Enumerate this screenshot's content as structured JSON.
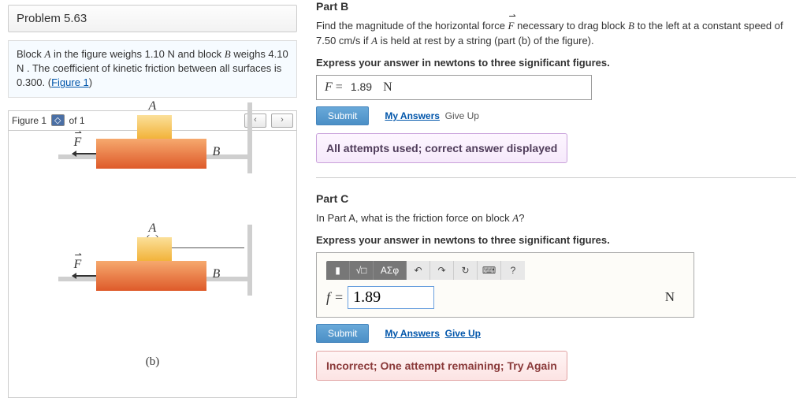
{
  "problem": {
    "header": "Problem 5.63",
    "desc_pre": "Block ",
    "desc_A": "A",
    "desc_mid1": " in the figure weighs 1.10 ",
    "desc_unitN1": "N",
    "desc_mid2": " and block ",
    "desc_B": "B",
    "desc_mid3": " weighs 4.10 ",
    "desc_unitN2": "N",
    "desc_mid4": " . The coefficient of kinetic friction between all surfaces is 0.300. (",
    "desc_figlink": "Figure 1",
    "desc_end": ")"
  },
  "figure": {
    "label": "Figure 1",
    "of": "of 1",
    "prev": "‹",
    "next": "›",
    "A": "A",
    "B": "B",
    "F": "F",
    "cap_a": "(a)",
    "cap_b": "(b)"
  },
  "partB": {
    "title": "Part B",
    "q_pre": "Find the magnitude of the horizontal force ",
    "q_F": "F",
    "q_mid1": " necessary to drag block ",
    "q_B": "B",
    "q_mid2": "  to the left at a constant speed of 7.50 ",
    "q_units": "cm/s",
    "q_mid3": " if ",
    "q_A": "A",
    "q_end": "  is held at rest by a string (part (b) of the figure).",
    "instr": "Express your answer in newtons to three significant figures.",
    "ansVar": "F",
    "ansEq": " = ",
    "ansVal": "1.89",
    "ansUnit": "N",
    "submit": "Submit",
    "myAnswers": "My Answers",
    "giveUp": "Give Up",
    "feedback": "All attempts used; correct answer displayed"
  },
  "partC": {
    "title": "Part C",
    "q_pre": "In Part A, what is the friction force on block ",
    "q_A": "A",
    "q_end": "?",
    "instr": "Express your answer in newtons to three significant figures.",
    "tool1": "▮",
    "tool2": "√□",
    "tool3": "ΑΣφ",
    "tool4": "↶",
    "tool5": "↷",
    "tool6": "↻",
    "tool7": "⌨",
    "tool8": "?",
    "ansVar": "f",
    "ansEq": " = ",
    "ansVal": "1.89",
    "ansUnit": "N",
    "submit": "Submit",
    "myAnswers": "My Answers",
    "giveUp": "Give Up",
    "feedback": "Incorrect; One attempt remaining; Try Again"
  }
}
